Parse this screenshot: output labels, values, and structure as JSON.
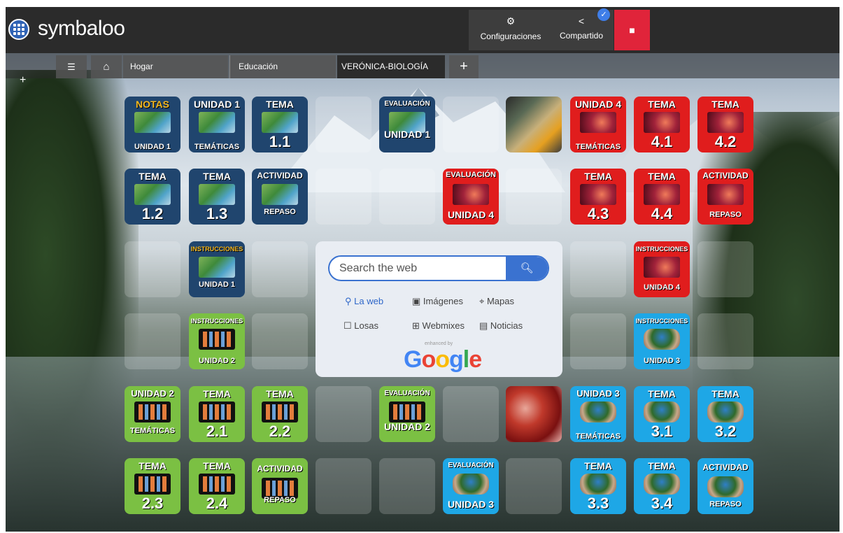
{
  "app": {
    "name": "symbaloo"
  },
  "toolbar": {
    "settings_label": "Configuraciones",
    "share_label": "Compartido",
    "settings_icon": "gear-icon",
    "share_icon": "share-icon",
    "delete_icon": "trash-icon",
    "check_icon": "check-icon"
  },
  "tabs": {
    "home_icon": "home-icon",
    "grid_icon": "list-icon",
    "items": [
      "Hogar",
      "Educación",
      "VERÓNICA-BIOLOGÍA"
    ],
    "add": "+",
    "side_add": "+"
  },
  "search": {
    "placeholder": "Search the web",
    "options": [
      "La web",
      "Imágenes",
      "Mapas",
      "Losas",
      "Webmixes",
      "Noticias"
    ],
    "selected": "La web",
    "enhanced": "enhanced by",
    "brand": "Google"
  },
  "tiles": {
    "r1": [
      {
        "top": "NOTAS",
        "bottom": "UNIDAD 1"
      },
      {
        "top": "UNIDAD 1",
        "bottom": "TEMÁTICAS"
      },
      {
        "top": "TEMA",
        "bottom": "1.1"
      },
      {
        "top": "EVALUACIÓN",
        "bottom": "UNIDAD 1"
      },
      {
        "top": "UNIDAD 4",
        "bottom": "TEMÁTICAS"
      },
      {
        "top": "TEMA",
        "bottom": "4.1"
      },
      {
        "top": "TEMA",
        "bottom": "4.2"
      }
    ],
    "r2": [
      {
        "top": "TEMA",
        "bottom": "1.2"
      },
      {
        "top": "TEMA",
        "bottom": "1.3"
      },
      {
        "top": "ACTIVIDAD",
        "bottom": "REPASO"
      },
      {
        "top": "EVALUACIÓN",
        "bottom": "UNIDAD 4"
      },
      {
        "top": "TEMA",
        "bottom": "4.3"
      },
      {
        "top": "TEMA",
        "bottom": "4.4"
      },
      {
        "top": "ACTIVIDAD",
        "bottom": "REPASO"
      }
    ],
    "r3": [
      {
        "top": "INSTRUCCIONES",
        "bottom": "UNIDAD 1"
      },
      {
        "top": "INSTRUCCIONES",
        "bottom": "UNIDAD 4"
      }
    ],
    "r4": [
      {
        "top": "INSTRUCCIONES",
        "bottom": "UNIDAD 2"
      },
      {
        "top": "INSTRUCCIONES",
        "bottom": "UNIDAD 3"
      }
    ],
    "r5": [
      {
        "top": "UNIDAD 2",
        "bottom": "TEMÁTICAS"
      },
      {
        "top": "TEMA",
        "bottom": "2.1"
      },
      {
        "top": "TEMA",
        "bottom": "2.2"
      },
      {
        "top": "EVALUACIÓN",
        "bottom": "UNIDAD 2"
      },
      {
        "top": "UNIDAD 3",
        "bottom": "TEMÁTICAS"
      },
      {
        "top": "TEMA",
        "bottom": "3.1"
      },
      {
        "top": "TEMA",
        "bottom": "3.2"
      }
    ],
    "r6": [
      {
        "top": "TEMA",
        "bottom": "2.3"
      },
      {
        "top": "TEMA",
        "bottom": "2.4"
      },
      {
        "top": "ACTIVIDAD",
        "bottom": "REPASO"
      },
      {
        "top": "EVALUACIÓN",
        "bottom": "UNIDAD 3"
      },
      {
        "top": "TEMA",
        "bottom": "3.3"
      },
      {
        "top": "TEMA",
        "bottom": "3.4"
      },
      {
        "top": "ACTIVIDAD",
        "bottom": "REPASO"
      }
    ]
  }
}
